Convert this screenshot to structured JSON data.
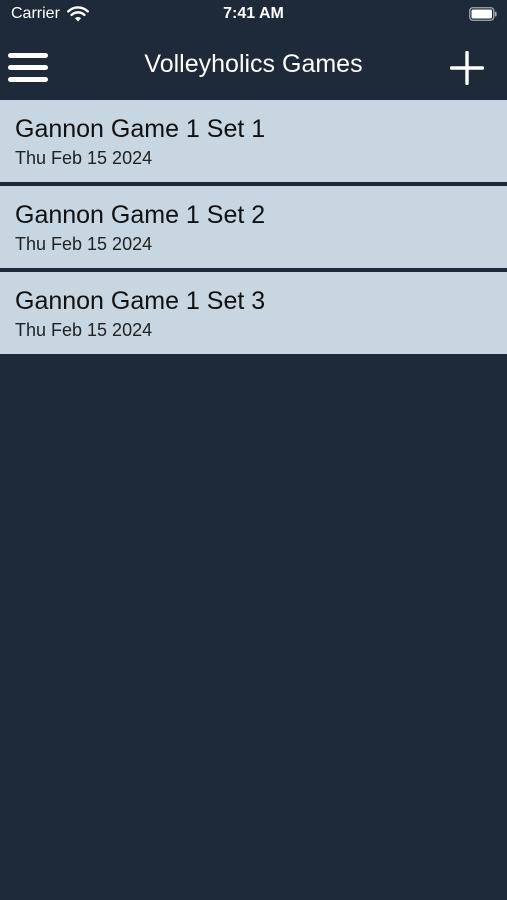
{
  "status": {
    "carrier": "Carrier",
    "time": "7:41 AM"
  },
  "nav": {
    "title": "Volleyholics Games"
  },
  "games": [
    {
      "name": "Gannon Game 1 Set 1",
      "date": "Thu Feb 15 2024"
    },
    {
      "name": "Gannon Game 1 Set 2",
      "date": "Thu Feb 15 2024"
    },
    {
      "name": "Gannon Game 1 Set 3",
      "date": "Thu Feb 15 2024"
    }
  ],
  "colors": {
    "background": "#1e2a3a",
    "row": "#c8d6e1",
    "text_light": "#ffffff"
  },
  "icons": {
    "menu": "hamburger-menu-icon",
    "add": "plus-icon",
    "wifi": "wifi-icon",
    "battery": "battery-icon"
  }
}
